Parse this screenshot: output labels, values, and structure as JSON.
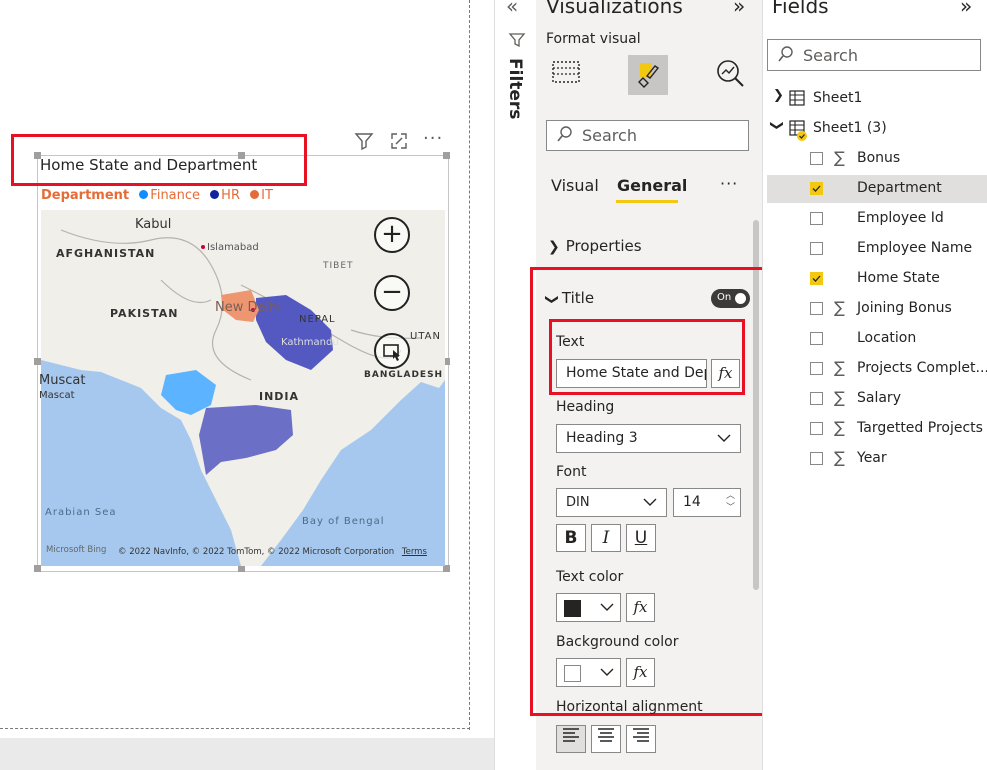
{
  "visual": {
    "title": "Home State and Department",
    "legend_label": "Department",
    "legend_items": [
      {
        "label": "Finance",
        "color": "#118dff"
      },
      {
        "label": "HR",
        "color": "#12239e"
      },
      {
        "label": "IT",
        "color": "#e66c37"
      }
    ],
    "map_labels": {
      "kabul": "Kabul",
      "islamabad": "Islamabad",
      "afghanistan": "AFGHANISTAN",
      "tibet": "TIBET",
      "new_delhi": "New Delhi",
      "pakistan": "PAKISTAN",
      "nepal": "NEPAL",
      "kathmandu": "Kathmandu",
      "bhutan": "UTAN",
      "muscat1": "Muscat",
      "muscat2": "Mascat",
      "bangladesh": "BANGLADESH",
      "india": "INDIA",
      "arabian_sea": "Arabian Sea",
      "bay_of_bengal": "Bay of Bengal"
    },
    "bing": "Microsoft Bing",
    "copyright": "© 2022 NavInfo, © 2022 TomTom, © 2022 Microsoft Corporation",
    "terms": "Terms",
    "zoom_in": "+",
    "zoom_out": "−"
  },
  "filters_label": "Filters",
  "visualizations": {
    "title": "Visualizations",
    "format_visual": "Format visual",
    "search_placeholder": "Search",
    "tabs": [
      "Visual",
      "General"
    ],
    "active_tab": "General",
    "more": "···",
    "properties_label": "Properties",
    "title_section": {
      "label": "Title",
      "toggle": "On",
      "text_label": "Text",
      "text_value": "Home State and Department",
      "heading_label": "Heading",
      "heading_value": "Heading 3",
      "font_label": "Font",
      "font_value": "DIN",
      "font_size": "14",
      "bold": "B",
      "italic": "I",
      "underline": "U",
      "text_color_label": "Text color",
      "text_color": "#252423",
      "background_color_label": "Background color",
      "background_color": "#ffffff",
      "horizontal_alignment_label": "Horizontal alignment",
      "fx": "fx"
    }
  },
  "fields": {
    "title": "Fields",
    "search_placeholder": "Search",
    "tables": [
      {
        "name": "Sheet1",
        "expanded": false
      },
      {
        "name": "Sheet1 (3)",
        "expanded": true
      }
    ],
    "items": [
      {
        "name": "Bonus",
        "sigma": true,
        "checked": false
      },
      {
        "name": "Department",
        "sigma": false,
        "checked": true
      },
      {
        "name": "Employee Id",
        "sigma": false,
        "checked": false
      },
      {
        "name": "Employee Name",
        "sigma": false,
        "checked": false
      },
      {
        "name": "Home State",
        "sigma": false,
        "checked": true
      },
      {
        "name": "Joining Bonus",
        "sigma": true,
        "checked": false
      },
      {
        "name": "Location",
        "sigma": false,
        "checked": false
      },
      {
        "name": "Projects Complet...",
        "sigma": true,
        "checked": false
      },
      {
        "name": "Salary",
        "sigma": true,
        "checked": false
      },
      {
        "name": "Targetted Projects",
        "sigma": true,
        "checked": false
      },
      {
        "name": "Year",
        "sigma": true,
        "checked": false
      }
    ]
  }
}
